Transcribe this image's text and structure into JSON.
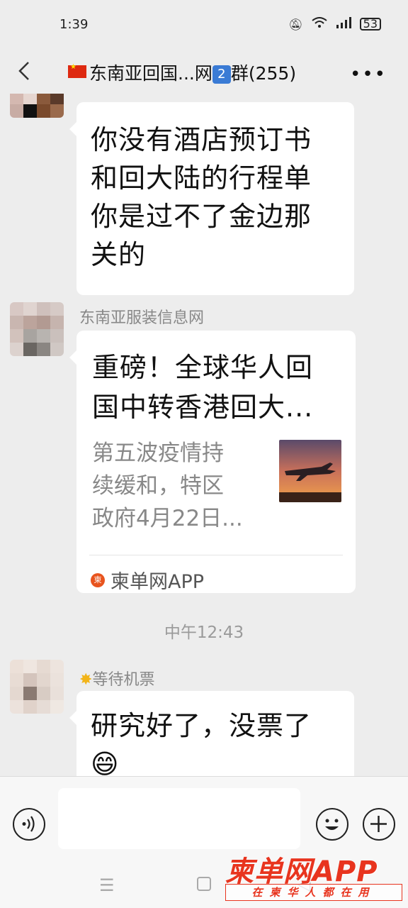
{
  "status_bar": {
    "time": "1:39",
    "battery": "53"
  },
  "header": {
    "title_part1": "东南亚回国...网",
    "title_badge": "2",
    "title_part2": "群(255)",
    "back_icon": "chevron-left-icon",
    "more_icon": "more-dots-icon"
  },
  "messages": [
    {
      "type": "text",
      "sender": "",
      "text_lines": [
        "你没有酒店预订书",
        "和回大陆的行程单",
        "你是过不了金边那",
        "关的"
      ]
    },
    {
      "type": "card",
      "sender": "东南亚服装信息网",
      "card_title_lines": [
        "重磅！全球华人回",
        "国中转香港回大..."
      ],
      "card_desc_lines": [
        "第五波疫情持",
        "续缓和，特区",
        "政府4月22日..."
      ],
      "card_source": "柬单网APP",
      "thumb_icon": "airplane-sunset-image"
    },
    {
      "type": "timestamp",
      "text": "中午12:43"
    },
    {
      "type": "text",
      "sender": "等待机票",
      "text_lines": [
        "研究好了，没票了",
        "😄"
      ]
    }
  ],
  "input_bar": {
    "placeholder": "",
    "voice_icon": "voice-icon",
    "emoji_icon": "emoji-icon",
    "plus_icon": "plus-icon"
  },
  "watermark": {
    "brand": "柬单网APP",
    "tagline": "在柬华人都在用"
  },
  "colors": {
    "background": "#ededed",
    "bubble": "#ffffff",
    "watermark_red": "#e8341e"
  }
}
